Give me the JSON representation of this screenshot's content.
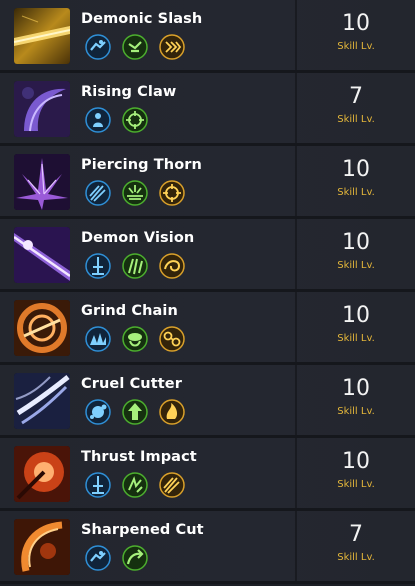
{
  "skills": [
    {
      "name": "Demonic Slash",
      "level": "10",
      "level_label": "Skill Lv.",
      "icon": "golden-slash-icon",
      "tripods": [
        "blue-dash-tripod-icon",
        "green-speed-tripod-icon",
        "gold-chevrons-tripod-icon"
      ]
    },
    {
      "name": "Rising Claw",
      "level": "7",
      "level_label": "Skill Lv.",
      "icon": "purple-claw-icon",
      "tripods": [
        "blue-figure-tripod-icon",
        "green-crosshair-tripod-icon"
      ]
    },
    {
      "name": "Piercing Thorn",
      "level": "10",
      "level_label": "Skill Lv.",
      "icon": "purple-thorn-icon",
      "tripods": [
        "blue-streaks-tripod-icon",
        "green-burst-tripod-icon",
        "gold-crosshair-tripod-icon"
      ]
    },
    {
      "name": "Demon Vision",
      "level": "10",
      "level_label": "Skill Lv.",
      "icon": "purple-beam-icon",
      "tripods": [
        "blue-sword-tripod-icon",
        "green-claw-tripod-icon",
        "gold-swirl-tripod-icon"
      ]
    },
    {
      "name": "Grind Chain",
      "level": "10",
      "level_label": "Skill Lv.",
      "icon": "orange-vortex-icon",
      "tripods": [
        "blue-spikes-tripod-icon",
        "green-hand-tripod-icon",
        "gold-chain-tripod-icon"
      ]
    },
    {
      "name": "Cruel Cutter",
      "level": "10",
      "level_label": "Skill Lv.",
      "icon": "white-cutter-icon",
      "tripods": [
        "blue-orb-tripod-icon",
        "green-arrow-tripod-icon",
        "gold-flame-tripod-icon"
      ]
    },
    {
      "name": "Thrust Impact",
      "level": "10",
      "level_label": "Skill Lv.",
      "icon": "orange-thrust-icon",
      "tripods": [
        "blue-sword-tripod-icon",
        "green-rune-tripod-icon",
        "gold-streaks-tripod-icon"
      ]
    },
    {
      "name": "Sharpened Cut",
      "level": "7",
      "level_label": "Skill Lv.",
      "icon": "orange-cut-icon",
      "tripods": [
        "blue-dash-tripod-icon",
        "green-curve-tripod-icon"
      ]
    }
  ],
  "colors": {
    "background": "#1c1f26",
    "level_label": "#e3b53a",
    "tripod_blue": "#2f8fd6",
    "tripod_green": "#4cae2e",
    "tripod_gold": "#d9a02a"
  }
}
